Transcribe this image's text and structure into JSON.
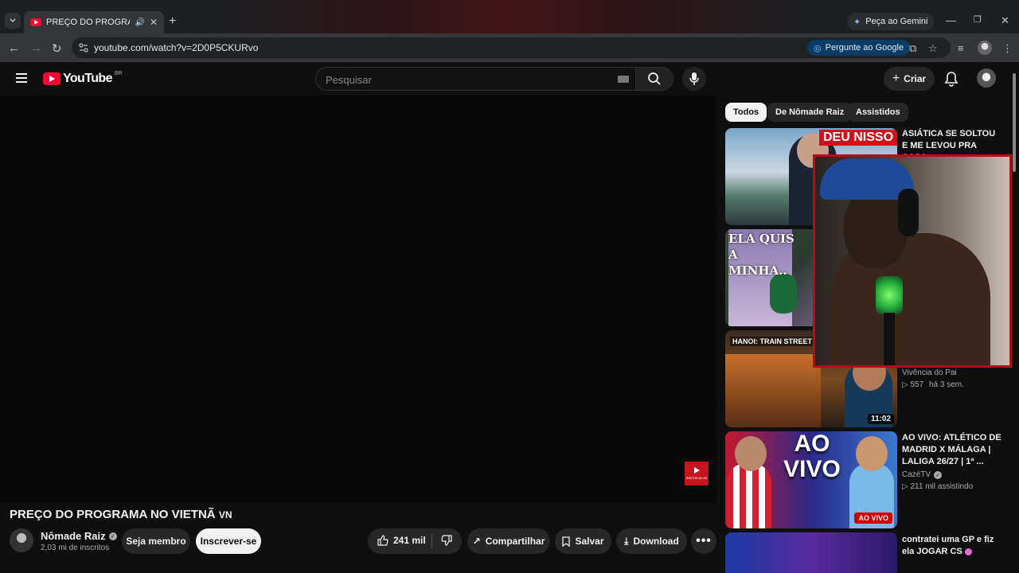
{
  "browser": {
    "tab_title": "PREÇO DO PROGRAMA NO VIETNÃ",
    "new_tab_label": "+",
    "gemini_label": "Peça ao Gemini",
    "url": "youtube.com/watch?v=2D0P5CKURvo",
    "ask_google_label": "Pergunte ao Google"
  },
  "header": {
    "logo_text": "YouTube",
    "country_code": "BR",
    "search_placeholder": "Pesquisar",
    "create_label": "Criar"
  },
  "video": {
    "title": "PREÇO DO PROGRAMA NO VIETNÃ",
    "title_flag": "VN",
    "channel_name": "Nômade Raiz",
    "subscribers": "2,03 mi de inscritos",
    "member_label": "Seja membro",
    "subscribe_label": "Inscrever-se",
    "likes": "241 mil",
    "share_label": "Compartilhar",
    "save_label": "Salvar",
    "download_label": "Download",
    "overlay_badge_text": "INSCREVA-SE"
  },
  "chips": [
    "Todos",
    "De Nômade Raiz",
    "Assistidos"
  ],
  "sidebar": [
    {
      "title": "ASIÁTICA SE SOLTOU E ME LEVOU PRA CASA",
      "thumb_text": "DEU NISSO"
    },
    {
      "thumb_text": "ELA QUIS A MINHA.."
    },
    {
      "channel": "Vivência do Pai",
      "views": "557",
      "age": "há 3 sem.",
      "duration": "11:02",
      "thumb_text": "HANOI: TRAIN STREET"
    },
    {
      "title": "AO VIVO: ATLÉTICO DE MADRID X MÁLAGA | LALIGA 26/27 | 1ª ...",
      "channel": "CazéTV",
      "views": "211 mil assistindo",
      "live_label": "AO VIVO",
      "thumb_text": "AO VIVO"
    },
    {
      "title": "contratei uma GP e fiz ela JOGAR CS"
    }
  ]
}
